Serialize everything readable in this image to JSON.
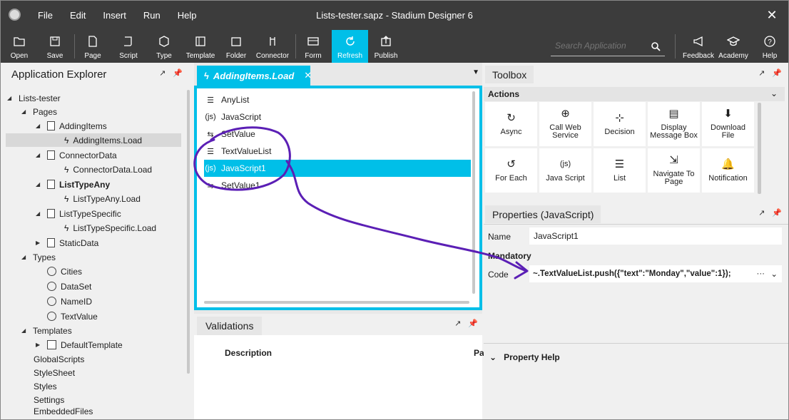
{
  "window": {
    "title": "Lists-tester.sapz - Stadium Designer 6",
    "close": "✕"
  },
  "menu": [
    "File",
    "Edit",
    "Insert",
    "Run",
    "Help"
  ],
  "toolbar": {
    "buttons": [
      "Open",
      "Save",
      "Page",
      "Script",
      "Type",
      "Template",
      "Folder",
      "Connector",
      "Form",
      "Refresh",
      "Publish"
    ],
    "search_placeholder": "Search Application",
    "right_buttons": [
      "Feedback",
      "Academy",
      "Help"
    ],
    "accent": "#00bfe8"
  },
  "explorer": {
    "title": "Application Explorer",
    "tree": [
      {
        "label": "Lists-tester"
      },
      {
        "label": "Pages"
      },
      {
        "label": "AddingItems"
      },
      {
        "label": "AddingItems.Load"
      },
      {
        "label": "ConnectorData"
      },
      {
        "label": "ConnectorData.Load"
      },
      {
        "label": "ListTypeAny"
      },
      {
        "label": "ListTypeAny.Load"
      },
      {
        "label": "ListTypeSpecific"
      },
      {
        "label": "ListTypeSpecific.Load"
      },
      {
        "label": "StaticData"
      },
      {
        "label": "Types"
      },
      {
        "label": "Cities"
      },
      {
        "label": "DataSet"
      },
      {
        "label": "NameID"
      },
      {
        "label": "TextValue"
      },
      {
        "label": "Templates"
      },
      {
        "label": "DefaultTemplate"
      },
      {
        "label": "GlobalScripts"
      },
      {
        "label": "StyleSheet"
      },
      {
        "label": "Styles"
      },
      {
        "label": "Settings"
      },
      {
        "label": "EmbeddedFiles"
      }
    ]
  },
  "editor": {
    "tab": "AddingItems.Load",
    "tab_close": "✕",
    "items": [
      {
        "label": "AnyList",
        "icon": "☰"
      },
      {
        "label": "JavaScript",
        "icon": "(js)"
      },
      {
        "label": "SetValue",
        "icon": "⇆"
      },
      {
        "label": "TextValueList",
        "icon": "☰"
      },
      {
        "label": "JavaScript1",
        "icon": "(js)"
      },
      {
        "label": "SetValue1",
        "icon": "⇆"
      }
    ]
  },
  "validations": {
    "title": "Validations",
    "col_description": "Description",
    "col_pa": "Pa"
  },
  "toolbox": {
    "title": "Toolbox",
    "section": "Actions",
    "tools": [
      {
        "label": "Async",
        "icon": "↻"
      },
      {
        "label": "Call Web Service",
        "icon": "⊕"
      },
      {
        "label": "Decision",
        "icon": "⊹"
      },
      {
        "label": "Display Message Box",
        "icon": "▤"
      },
      {
        "label": "Download File",
        "icon": "⬇"
      },
      {
        "label": "For Each",
        "icon": "↺"
      },
      {
        "label": "Java Script",
        "icon": "(js)"
      },
      {
        "label": "List",
        "icon": "☰"
      },
      {
        "label": "Navigate To Page",
        "icon": "⇲"
      },
      {
        "label": "Notification",
        "icon": "🔔"
      }
    ]
  },
  "properties": {
    "title": "Properties (JavaScript)",
    "name_label": "Name",
    "name_value": "JavaScript1",
    "mandatory_label": "Mandatory",
    "code_label": "Code",
    "code_value": "~.TextValueList.push({\"text\":\"Monday\",\"value\":1});",
    "help_label": "Property Help"
  },
  "annotation_color": "#5b1fb5"
}
